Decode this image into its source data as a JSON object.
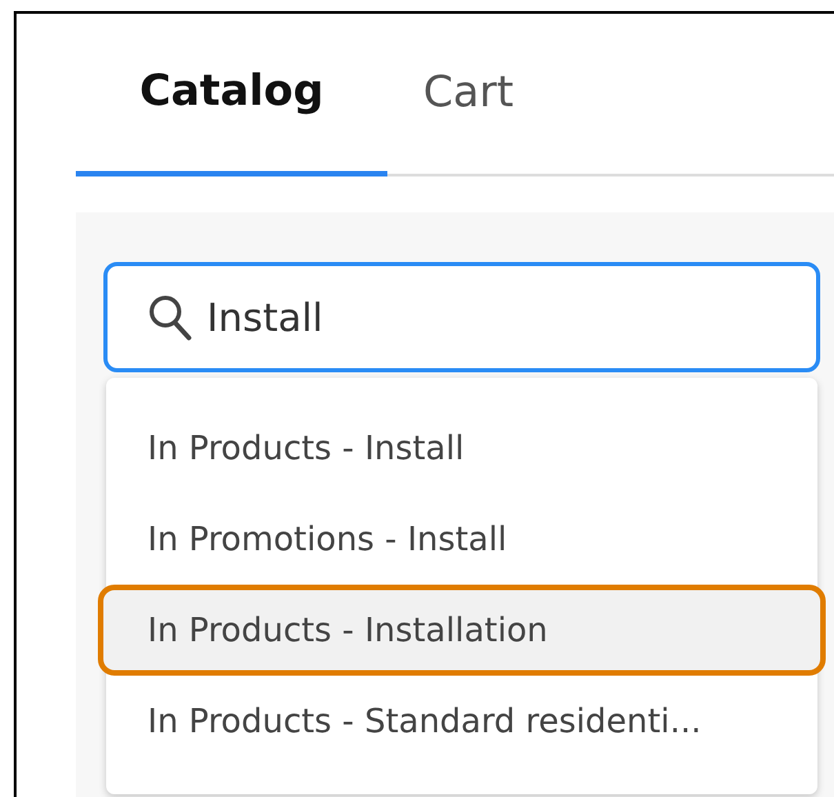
{
  "tabs": [
    {
      "label": "Catalog",
      "selected": true
    },
    {
      "label": "Cart",
      "selected": false
    }
  ],
  "search": {
    "value": "Install"
  },
  "suggestions": [
    {
      "label": "In Products - Install",
      "selected": false
    },
    {
      "label": "In Promotions - Install",
      "selected": false
    },
    {
      "label": "In Products - Installation",
      "selected": true
    },
    {
      "label": "In Products - Standard residenti...",
      "selected": false
    }
  ]
}
